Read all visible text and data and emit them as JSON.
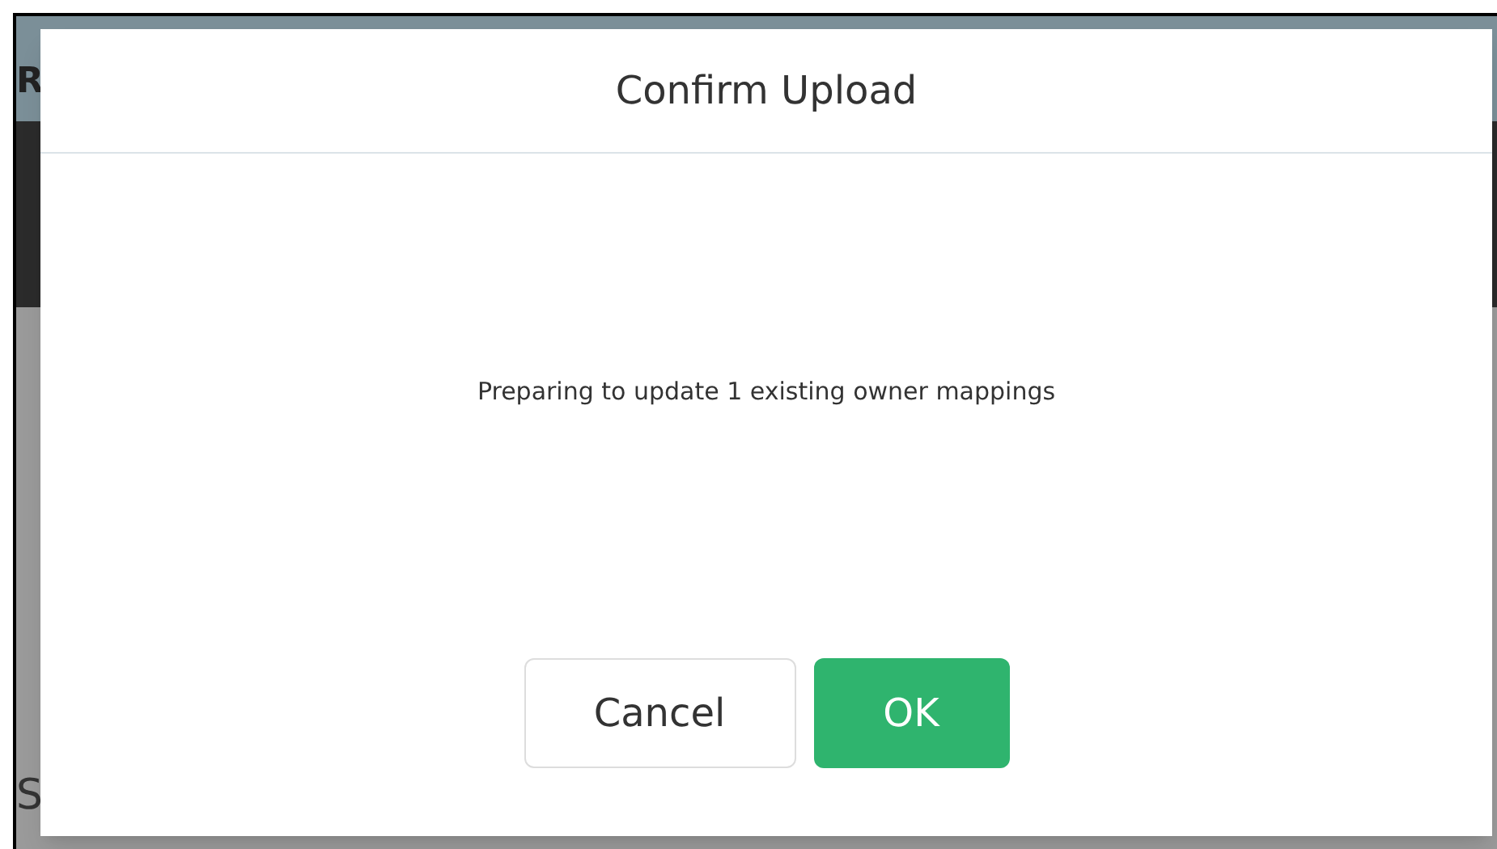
{
  "background": {
    "header_fragment": "R",
    "section_fragment": "S"
  },
  "dialog": {
    "title": "Confirm Upload",
    "message": "Preparing to update 1 existing owner mappings",
    "buttons": [
      {
        "label": "Cancel",
        "kind": "secondary"
      },
      {
        "label": "OK",
        "kind": "primary"
      }
    ]
  }
}
